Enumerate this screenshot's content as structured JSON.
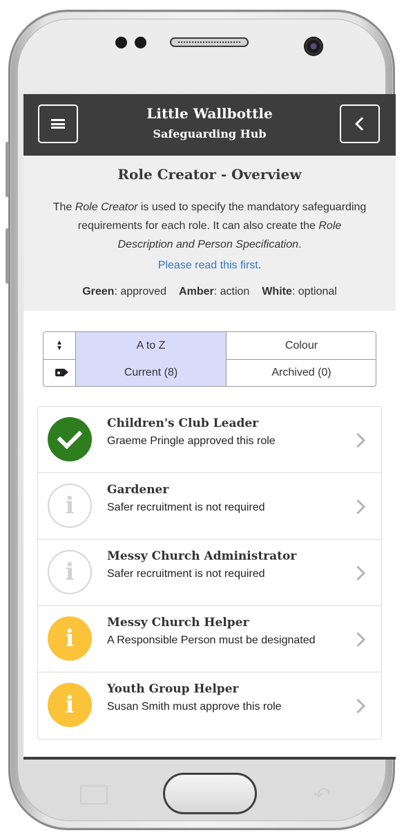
{
  "header": {
    "title": "Little Wallbottle",
    "subtitle": "Safeguarding Hub"
  },
  "overview": {
    "title": "Role Creator - Overview",
    "intro_parts": {
      "p1": "The ",
      "p2": "Role Creator",
      "p3": " is used to specify the mandatory safeguarding requirements for each role.  It can also create the ",
      "p4": "Role Description and Person Specification",
      "p5": "."
    },
    "link_text": "Please read this first",
    "link_suffix": ".",
    "legend": [
      {
        "key": "Green",
        "value": ": approved"
      },
      {
        "key": "Amber",
        "value": ": action"
      },
      {
        "key": "White",
        "value": ": optional"
      }
    ]
  },
  "controls": {
    "sort": {
      "options": [
        "A to Z",
        "Colour"
      ],
      "selected": "A to Z"
    },
    "filter": {
      "options": [
        "Current (8)",
        "Archived (0)"
      ],
      "selected": "Current (8)"
    }
  },
  "roles": [
    {
      "title": "Children's Club Leader",
      "status": "Graeme Pringle approved this role",
      "state": "green"
    },
    {
      "title": "Gardener",
      "status": "Safer recruitment is not required",
      "state": "white"
    },
    {
      "title": "Messy Church Administrator",
      "status": "Safer recruitment is not required",
      "state": "white"
    },
    {
      "title": "Messy Church Helper",
      "status": "A Responsible Person must be designated",
      "state": "amber"
    },
    {
      "title": "Youth Group Helper",
      "status": "Susan Smith must approve this role",
      "state": "amber"
    }
  ],
  "colors": {
    "header_bg": "#3d3d3d",
    "green": "#2e7d1e",
    "amber": "#fbc33a",
    "link": "#2f77c4",
    "selected_cell": "#d9dbfb"
  },
  "icons": {
    "menu": "hamburger-icon",
    "back": "chevron-left-icon",
    "sort": "sort-icon",
    "filter": "tag-icon",
    "approved": "check-icon",
    "info": "info-icon",
    "row_arrow": "chevron-right-icon"
  }
}
